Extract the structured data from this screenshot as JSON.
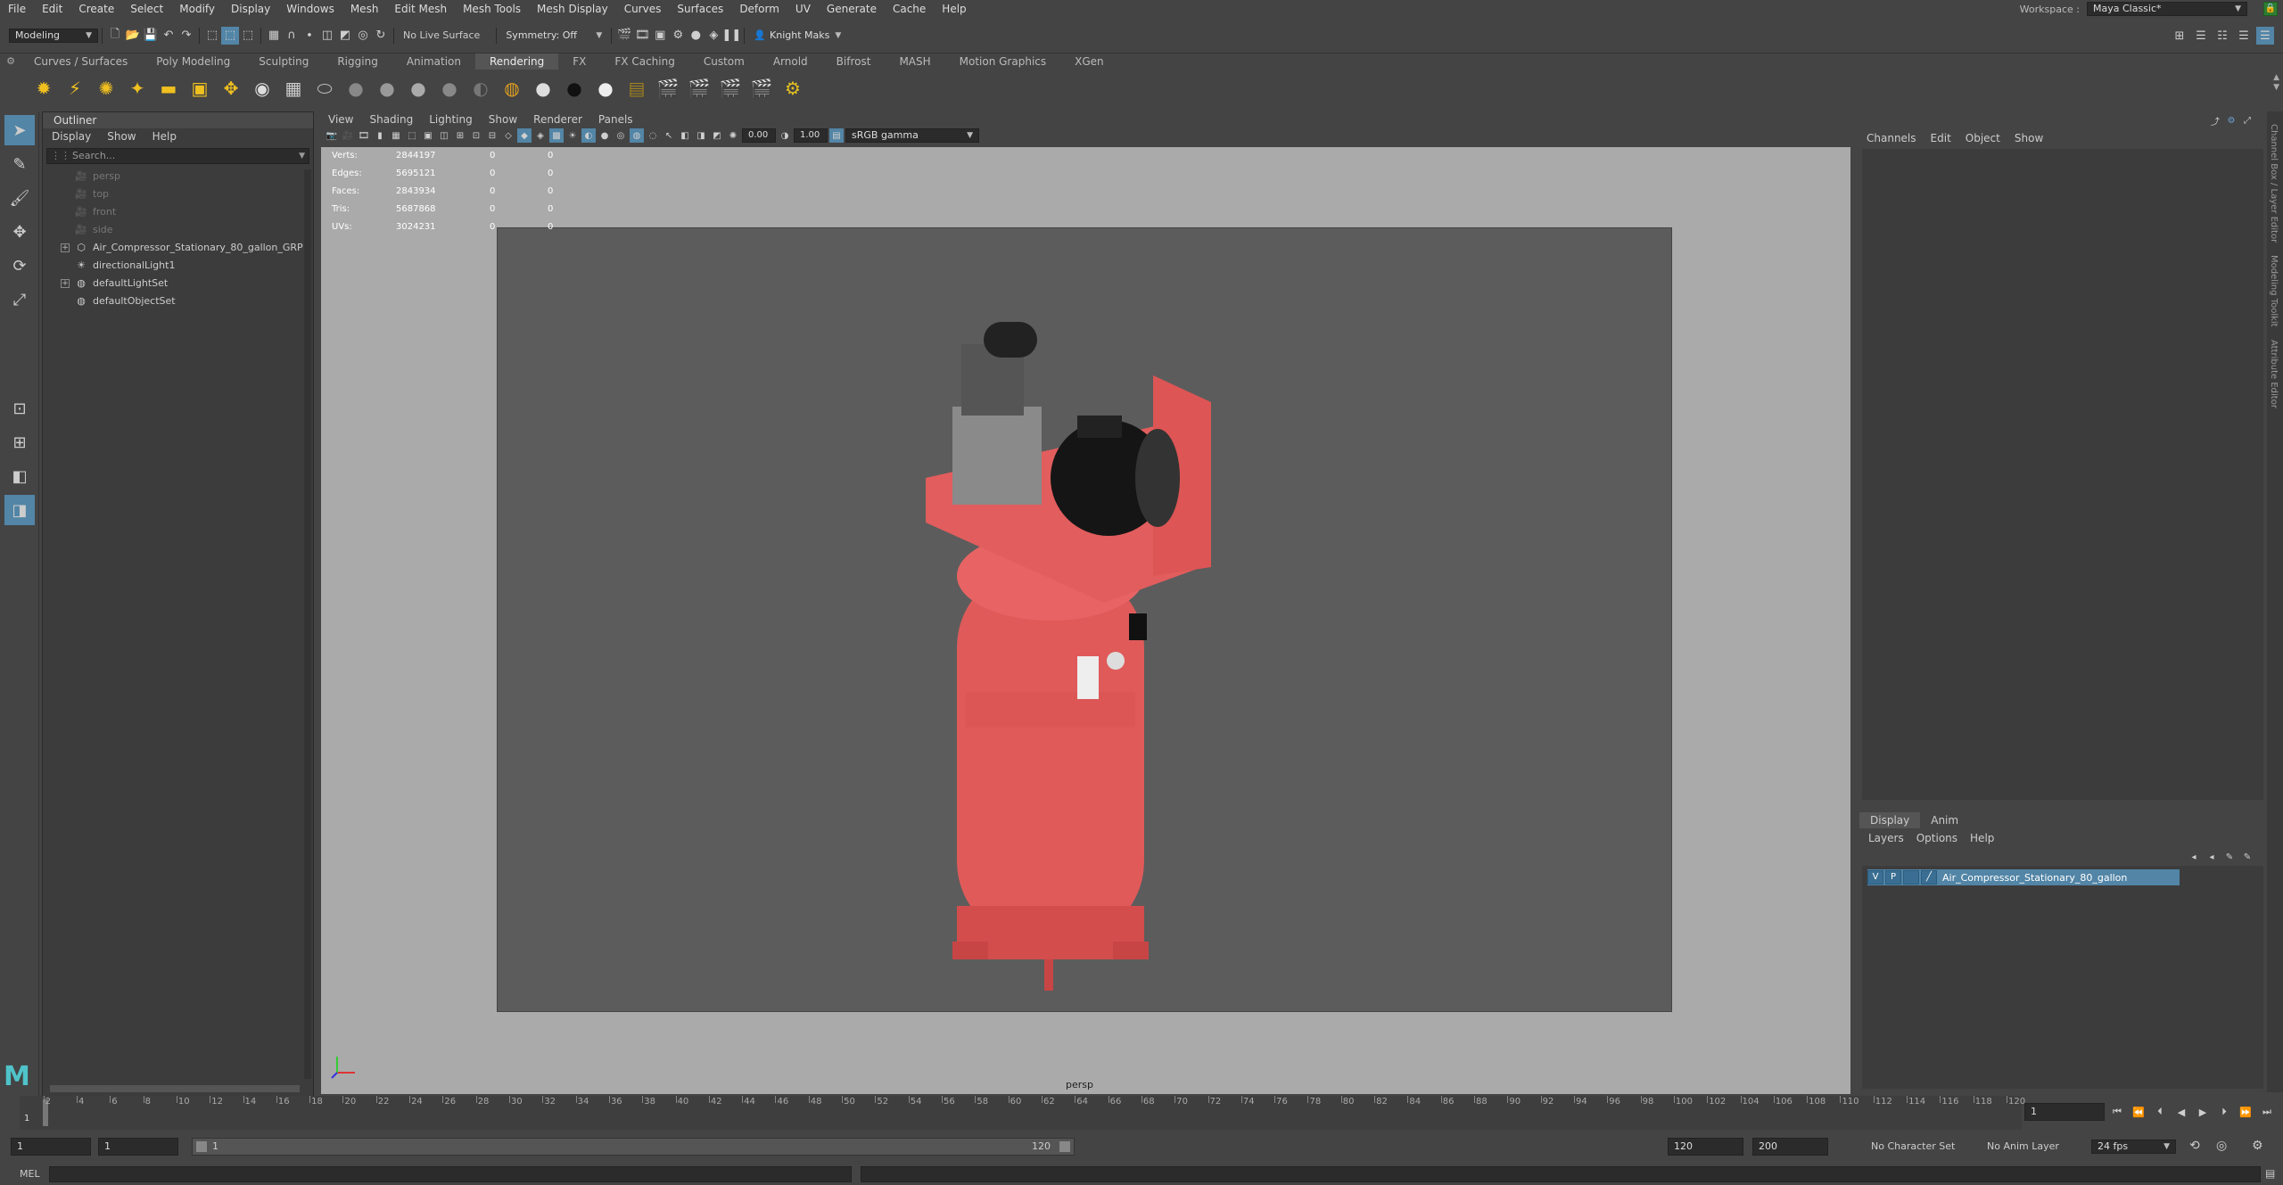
{
  "menubar": {
    "items": [
      "File",
      "Edit",
      "Create",
      "Select",
      "Modify",
      "Display",
      "Windows",
      "Mesh",
      "Edit Mesh",
      "Mesh Tools",
      "Mesh Display",
      "Curves",
      "Surfaces",
      "Deform",
      "UV",
      "Generate",
      "Cache",
      "Help"
    ],
    "workspace_label": "Workspace :",
    "workspace_value": "Maya Classic*"
  },
  "statusline": {
    "mode": "Modeling",
    "live_surface": "No Live Surface",
    "symmetry": "Symmetry: Off",
    "user": "Knight Maks"
  },
  "shelf": {
    "tabs": [
      "Curves / Surfaces",
      "Poly Modeling",
      "Sculpting",
      "Rigging",
      "Animation",
      "Rendering",
      "FX",
      "FX Caching",
      "Custom",
      "Arnold",
      "Bifrost",
      "MASH",
      "Motion Graphics",
      "XGen"
    ],
    "active_tab": "Rendering"
  },
  "outliner": {
    "title": "Outliner",
    "menus": [
      "Display",
      "Show",
      "Help"
    ],
    "search_placeholder": "Search...",
    "items": [
      {
        "label": "persp",
        "icon": "camera-icon",
        "dim": true,
        "expandable": false
      },
      {
        "label": "top",
        "icon": "camera-icon",
        "dim": true,
        "expandable": false
      },
      {
        "label": "front",
        "icon": "camera-icon",
        "dim": true,
        "expandable": false
      },
      {
        "label": "side",
        "icon": "camera-icon",
        "dim": true,
        "expandable": false
      },
      {
        "label": "Air_Compressor_Stationary_80_gallon_GRP",
        "icon": "group-icon",
        "dim": false,
        "expandable": true
      },
      {
        "label": "directionalLight1",
        "icon": "light-icon",
        "dim": false,
        "expandable": false
      },
      {
        "label": "defaultLightSet",
        "icon": "set-icon",
        "dim": false,
        "expandable": true
      },
      {
        "label": "defaultObjectSet",
        "icon": "set-icon",
        "dim": false,
        "expandable": false
      }
    ]
  },
  "viewport": {
    "menus": [
      "View",
      "Shading",
      "Lighting",
      "Show",
      "Renderer",
      "Panels"
    ],
    "exposure": "0.00",
    "gamma": "1.00",
    "color_space": "sRGB gamma",
    "camera": "persp",
    "hud": [
      {
        "k": "Verts:",
        "v": "2844197",
        "a": "0",
        "b": "0"
      },
      {
        "k": "Edges:",
        "v": "5695121",
        "a": "0",
        "b": "0"
      },
      {
        "k": "Faces:",
        "v": "2843934",
        "a": "0",
        "b": "0"
      },
      {
        "k": "Tris:",
        "v": "5687868",
        "a": "0",
        "b": "0"
      },
      {
        "k": "UVs:",
        "v": "3024231",
        "a": "0",
        "b": "0"
      }
    ]
  },
  "channelbox": {
    "menus": [
      "Channels",
      "Edit",
      "Object",
      "Show"
    ]
  },
  "layereditor": {
    "tabs": [
      "Display",
      "Anim"
    ],
    "menus": [
      "Layers",
      "Options",
      "Help"
    ],
    "layer": {
      "v": "V",
      "p": "P",
      "name": "Air_Compressor_Stationary_80_gallon"
    }
  },
  "sidetabs": [
    "Channel Box / Layer Editor",
    "Modeling Toolkit",
    "Attribute Editor"
  ],
  "timeslider": {
    "ticks": [
      "2",
      "4",
      "6",
      "8",
      "10",
      "12",
      "14",
      "16",
      "18",
      "20",
      "22",
      "24",
      "26",
      "28",
      "30",
      "32",
      "34",
      "36",
      "38",
      "40",
      "42",
      "44",
      "46",
      "48",
      "50",
      "52",
      "54",
      "56",
      "58",
      "60",
      "62",
      "64",
      "66",
      "68",
      "70",
      "72",
      "74",
      "76",
      "78",
      "80",
      "82",
      "84",
      "86",
      "88",
      "90",
      "92",
      "94",
      "96",
      "98",
      "100",
      "102",
      "104",
      "106",
      "108",
      "110",
      "112",
      "114",
      "116",
      "118",
      "120"
    ],
    "current": "1",
    "current_field": "1"
  },
  "rangeslider": {
    "start": "1",
    "start2": "1",
    "range_start": "1",
    "range_end": "120",
    "end": "120",
    "end2": "200",
    "character_set": "No Character Set",
    "anim_layer": "No Anim Layer",
    "fps": "24 fps"
  },
  "commandline": {
    "lang": "MEL"
  }
}
